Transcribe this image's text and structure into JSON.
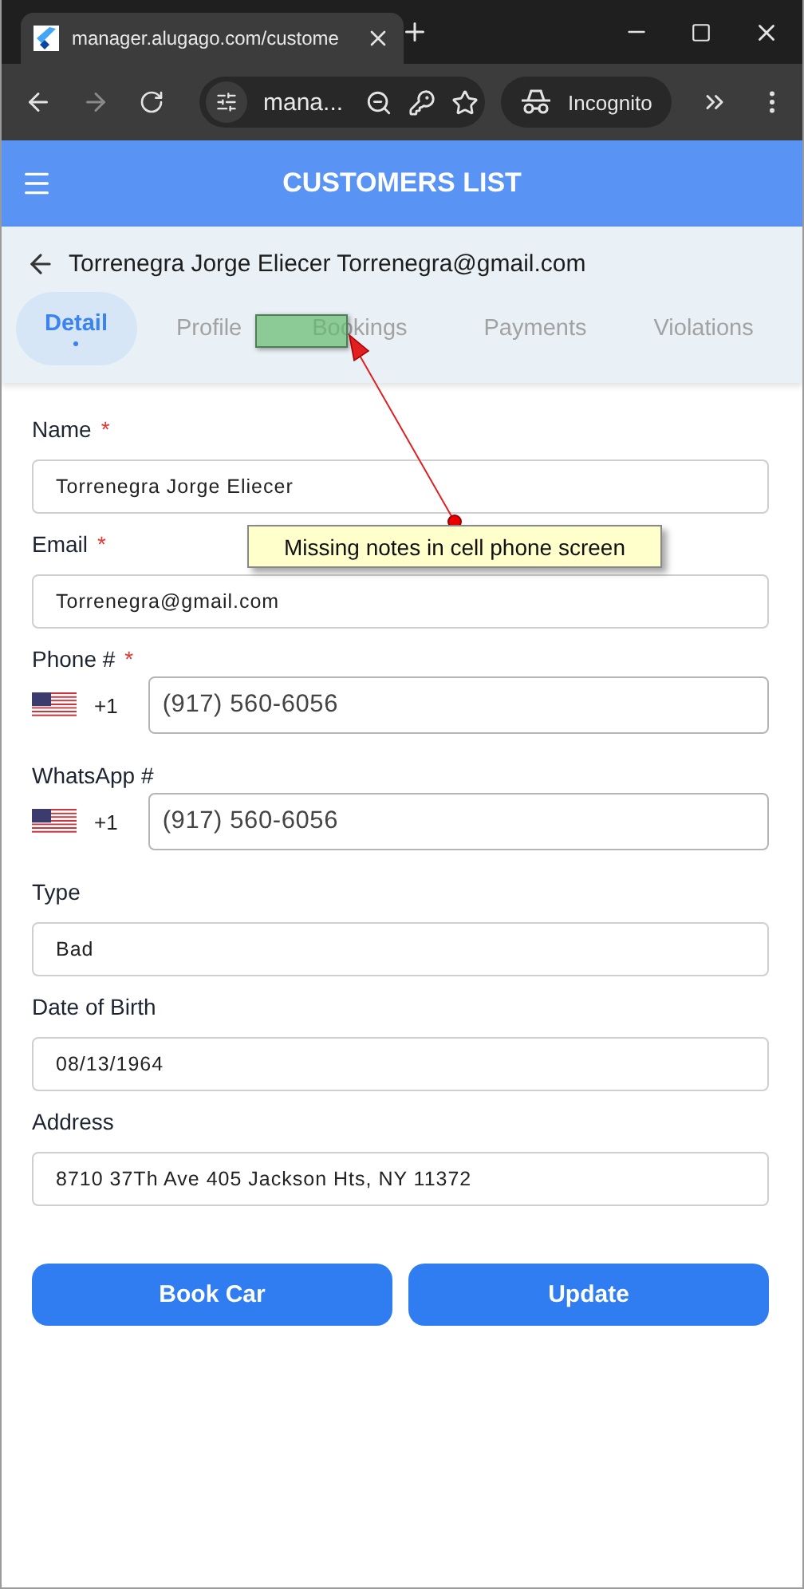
{
  "browser": {
    "tab_title": "manager.alugago.com/custome",
    "address": "mana...",
    "profile_label": "Incognito"
  },
  "app_bar": {
    "title": "CUSTOMERS LIST"
  },
  "customer_header": "Torrenegra Jorge Eliecer Torrenegra@gmail.com",
  "tabs": [
    {
      "label": "Detail",
      "selected": true
    },
    {
      "label": "Profile",
      "selected": false
    },
    {
      "label": "Bookings",
      "selected": false
    },
    {
      "label": "Payments",
      "selected": false
    },
    {
      "label": "Violations",
      "selected": false
    }
  ],
  "fields": [
    {
      "kind": "text",
      "label": "Name",
      "required_mark": "*",
      "value": "Torrenegra Jorge Eliecer"
    },
    {
      "kind": "text",
      "label": "Email",
      "required_mark": "*",
      "value": "Torrenegra@gmail.com"
    },
    {
      "kind": "phone",
      "label": "Phone #",
      "required_mark": "*",
      "dial_code": "+1",
      "value": "(917) 560-6056"
    },
    {
      "kind": "phone",
      "label": "WhatsApp #",
      "dial_code": "+1",
      "value": "(917) 560-6056"
    },
    {
      "kind": "text",
      "label": "Type",
      "value": "Bad"
    },
    {
      "kind": "text",
      "label": "Date of Birth",
      "value": "08/13/1964"
    },
    {
      "kind": "text",
      "label": "Address",
      "value": "8710 37Th Ave 405 Jackson Hts, NY 11372"
    }
  ],
  "buttons": [
    "Book Car",
    "Update"
  ],
  "annotation": {
    "note": "Missing notes in cell phone screen"
  }
}
